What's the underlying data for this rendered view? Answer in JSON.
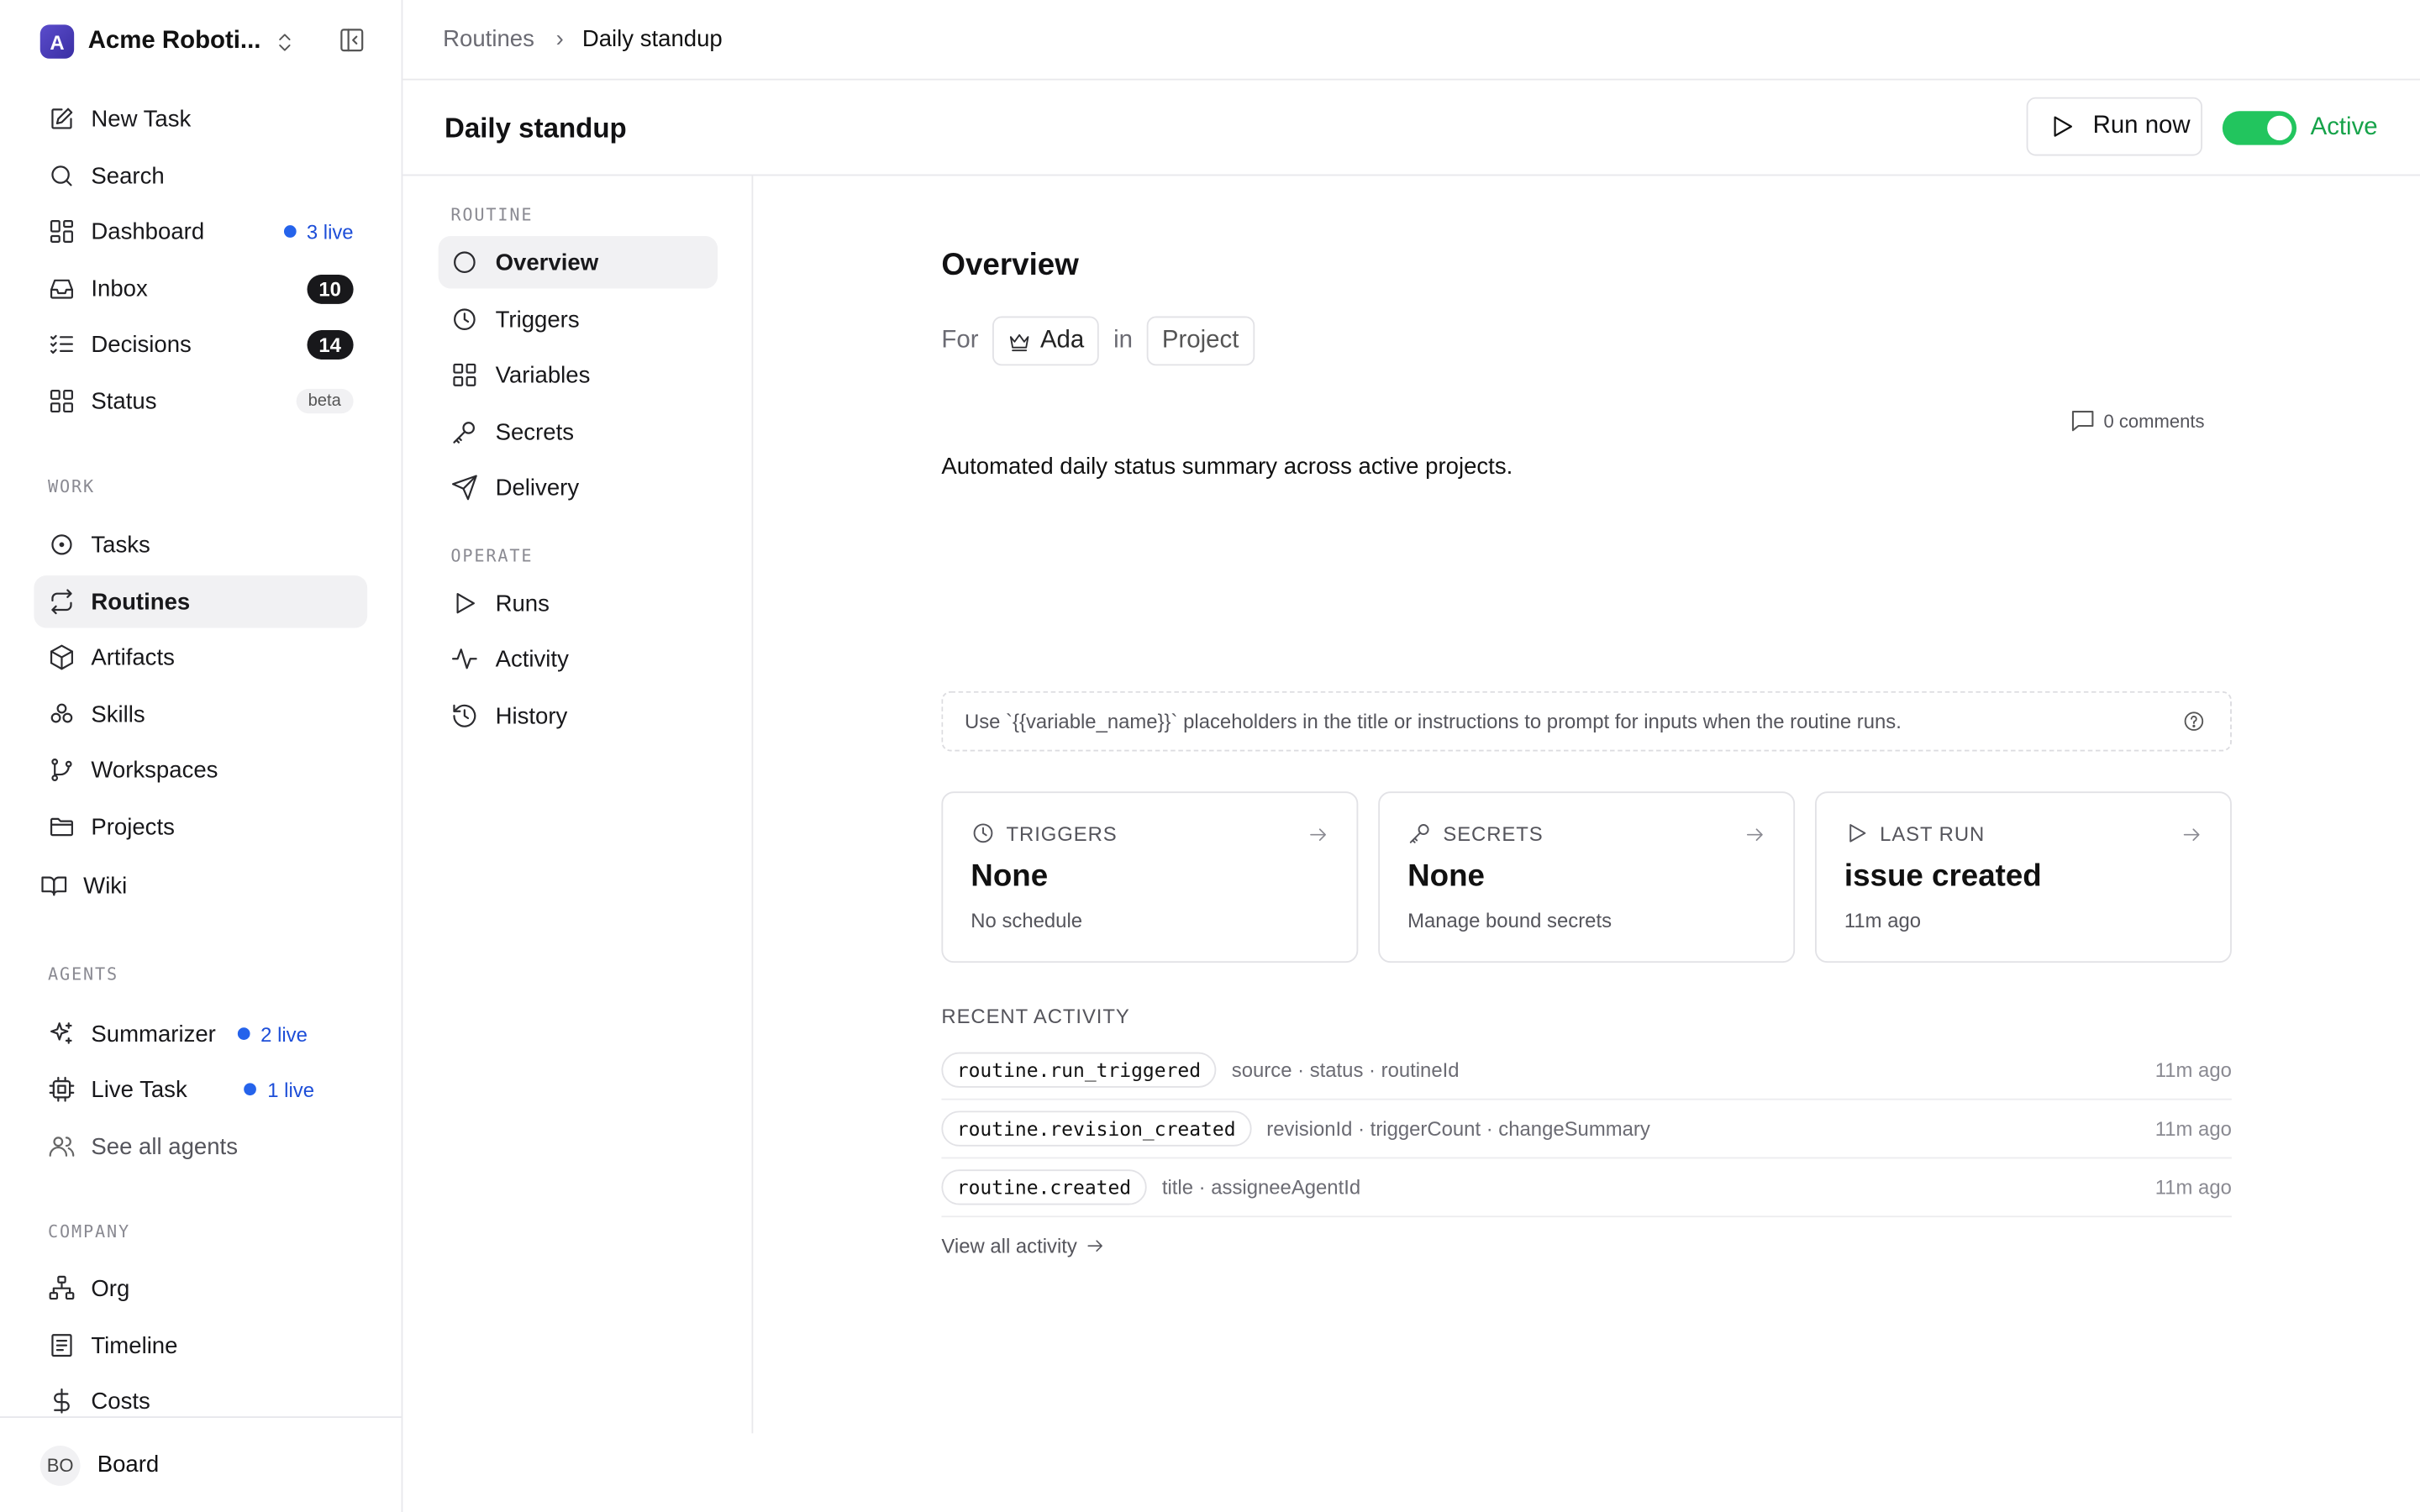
{
  "workspace": {
    "logo_letter": "A",
    "name": "Acme Roboti..."
  },
  "sidebar": {
    "top_items": [
      {
        "label": "New Task",
        "icon": "edit-icon"
      },
      {
        "label": "Search",
        "icon": "search-icon"
      },
      {
        "label": "Dashboard",
        "icon": "dashboard-icon",
        "badge": "3 live"
      },
      {
        "label": "Inbox",
        "icon": "inbox-icon",
        "count": "10"
      },
      {
        "label": "Decisions",
        "icon": "list-check-icon",
        "count": "14"
      },
      {
        "label": "Status",
        "icon": "grid-icon",
        "tag": "beta"
      }
    ],
    "work_label": "WORK",
    "work_items": [
      {
        "label": "Tasks",
        "icon": "circle-dot-icon"
      },
      {
        "label": "Routines",
        "icon": "repeat-icon",
        "active": true
      },
      {
        "label": "Artifacts",
        "icon": "box-icon"
      },
      {
        "label": "Skills",
        "icon": "skills-icon"
      },
      {
        "label": "Workspaces",
        "icon": "git-branch-icon"
      },
      {
        "label": "Projects",
        "icon": "folder-icon"
      },
      {
        "label": "Wiki",
        "icon": "book-icon"
      }
    ],
    "agents_label": "AGENTS",
    "agent_items": [
      {
        "label": "Summarizer",
        "icon": "sparkles-icon",
        "badge": "2 live"
      },
      {
        "label": "Live Task",
        "icon": "cpu-icon",
        "badge": "1 live"
      },
      {
        "label": "See all agents",
        "icon": "users-icon"
      }
    ],
    "company_label": "COMPANY",
    "company_items": [
      {
        "label": "Org",
        "icon": "org-chart-icon"
      },
      {
        "label": "Timeline",
        "icon": "timeline-icon"
      },
      {
        "label": "Costs",
        "icon": "dollar-icon"
      }
    ],
    "footer": {
      "initials": "BO",
      "label": "Board"
    }
  },
  "breadcrumb": {
    "parent": "Routines",
    "separator": "›",
    "current": "Daily standup"
  },
  "header": {
    "title": "Daily standup",
    "run_label": "Run now",
    "status_label": "Active",
    "status_color": "#22c55e"
  },
  "subnav": {
    "routine_label": "ROUTINE",
    "routine_items": [
      {
        "label": "Overview",
        "icon": "circle-icon",
        "active": true
      },
      {
        "label": "Triggers",
        "icon": "clock-icon"
      },
      {
        "label": "Variables",
        "icon": "grid-icon"
      },
      {
        "label": "Secrets",
        "icon": "key-icon"
      },
      {
        "label": "Delivery",
        "icon": "send-icon"
      }
    ],
    "operate_label": "OPERATE",
    "operate_items": [
      {
        "label": "Runs",
        "icon": "play-icon"
      },
      {
        "label": "Activity",
        "icon": "activity-icon"
      },
      {
        "label": "History",
        "icon": "history-icon"
      }
    ]
  },
  "overview": {
    "title": "Overview",
    "for_label": "For",
    "agent": "Ada",
    "in_label": "in",
    "project": "Project",
    "comments": "0 comments",
    "description": "Automated daily status summary across active projects.",
    "hint": "Use `{{variable_name}}` placeholders in the title or instructions to prompt for inputs when the routine runs.",
    "cards": [
      {
        "label": "TRIGGERS",
        "icon": "clock-icon",
        "value": "None",
        "sub": "No schedule"
      },
      {
        "label": "SECRETS",
        "icon": "key-icon",
        "value": "None",
        "sub": "Manage bound secrets"
      },
      {
        "label": "LAST RUN",
        "icon": "play-icon",
        "value": "issue created",
        "sub": "11m ago"
      }
    ],
    "recent_label": "RECENT ACTIVITY",
    "activity": [
      {
        "event": "routine.run_triggered",
        "fields": "source · status · routineId",
        "when": "11m ago"
      },
      {
        "event": "routine.revision_created",
        "fields": "revisionId · triggerCount · changeSummary",
        "when": "11m ago"
      },
      {
        "event": "routine.created",
        "fields": "title · assigneeAgentId",
        "when": "11m ago"
      }
    ],
    "view_all": "View all activity"
  }
}
